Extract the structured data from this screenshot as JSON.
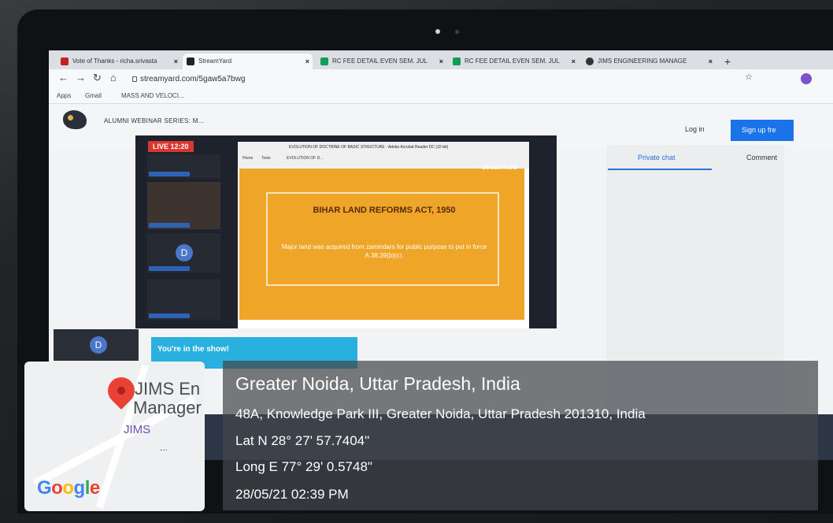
{
  "browser": {
    "tabs": [
      {
        "label": "Vote of Thanks - richa.srivasta",
        "icon_color": "#c5221f"
      },
      {
        "label": "StreamYard",
        "icon_color": "#222222"
      },
      {
        "label": "RC FEE DETAIL EVEN SEM. JUL",
        "icon_color": "#0f9d58"
      },
      {
        "label": "RC FEE DETAIL EVEN SEM. JUL",
        "icon_color": "#0f9d58"
      },
      {
        "label": "JIMS ENGINEERING MANAGE",
        "icon_color": "#333333"
      }
    ],
    "url": "streamyard.com/5gaw5a7bwg",
    "bookmarks": [
      "Apps",
      "Gmail",
      "MASS AND VELOCI..."
    ]
  },
  "app": {
    "title": "ALUMNI WEBINAR SERIES: M...",
    "login": "Log in",
    "signup": "Sign up fre",
    "live_badge": "LIVE 12:20",
    "avatar_letter": "D",
    "private_chat": "Private chat",
    "comments": "Comment",
    "banner": "You're in the show!",
    "pdf_title": "EVOLUTION OF DOCTRINE OF BASIC STRUCTURE - Adobe Acrobat Reader DC (32-bit)",
    "pdf_tabs": [
      "Home",
      "Tools",
      "EVOLUTION OF D..."
    ],
    "slide_title": "BIHAR LAND REFORMS ACT, 1950",
    "slide_body": "Major land was acquired from zamindars for public purpose to put in force A.38,39(b)(c).",
    "watermark": "StreamYard"
  },
  "map": {
    "place_line1": "JIMS En",
    "place_line2": "Manager",
    "place_short": "JIMS",
    "google": [
      "G",
      "o",
      "o",
      "g",
      "l",
      "e"
    ],
    "more": "..."
  },
  "geotag": {
    "city": "Greater Noida, Uttar Pradesh, India",
    "address": "48A, Knowledge Park III, Greater Noida, Uttar Pradesh 201310, India",
    "lat": "Lat N 28° 27' 57.7404\"",
    "long": "Long E 77° 29' 0.5748\"",
    "datetime": "28/05/21 02:39 PM"
  },
  "colors": {
    "accent": "#1a73e8",
    "live": "#d9362f",
    "slide": "#efa528",
    "pin": "#e94235"
  }
}
